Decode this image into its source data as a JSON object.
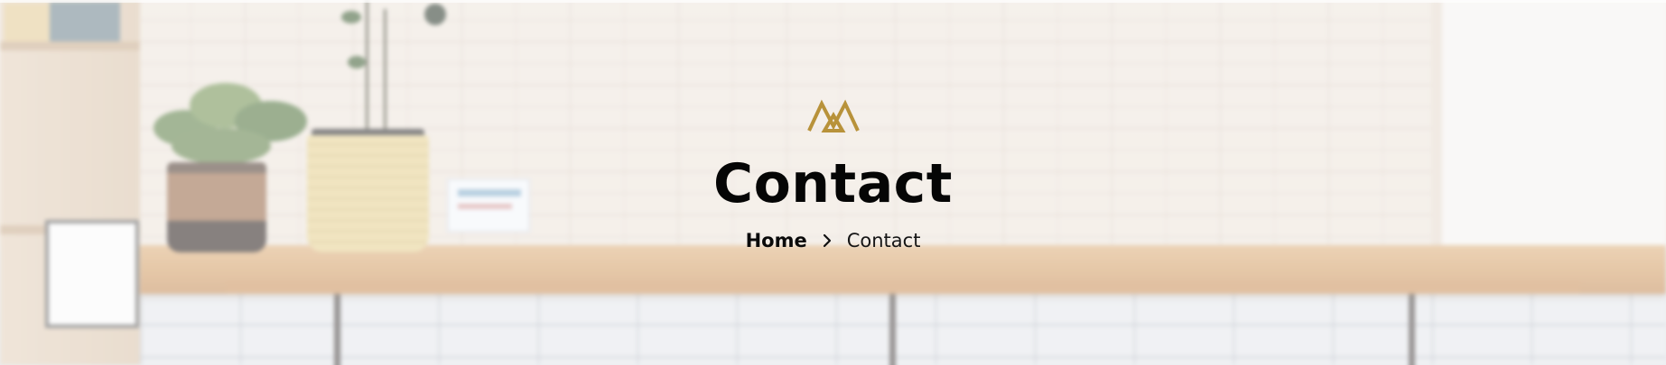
{
  "hero": {
    "title": "Contact",
    "logo_icon": "brand-logo-icon",
    "accent_color": "#b8923a"
  },
  "breadcrumb": {
    "items": [
      {
        "label": "Home",
        "link": true
      },
      {
        "label": "Contact",
        "link": false
      }
    ],
    "separator_icon": "chevron-right-icon"
  }
}
